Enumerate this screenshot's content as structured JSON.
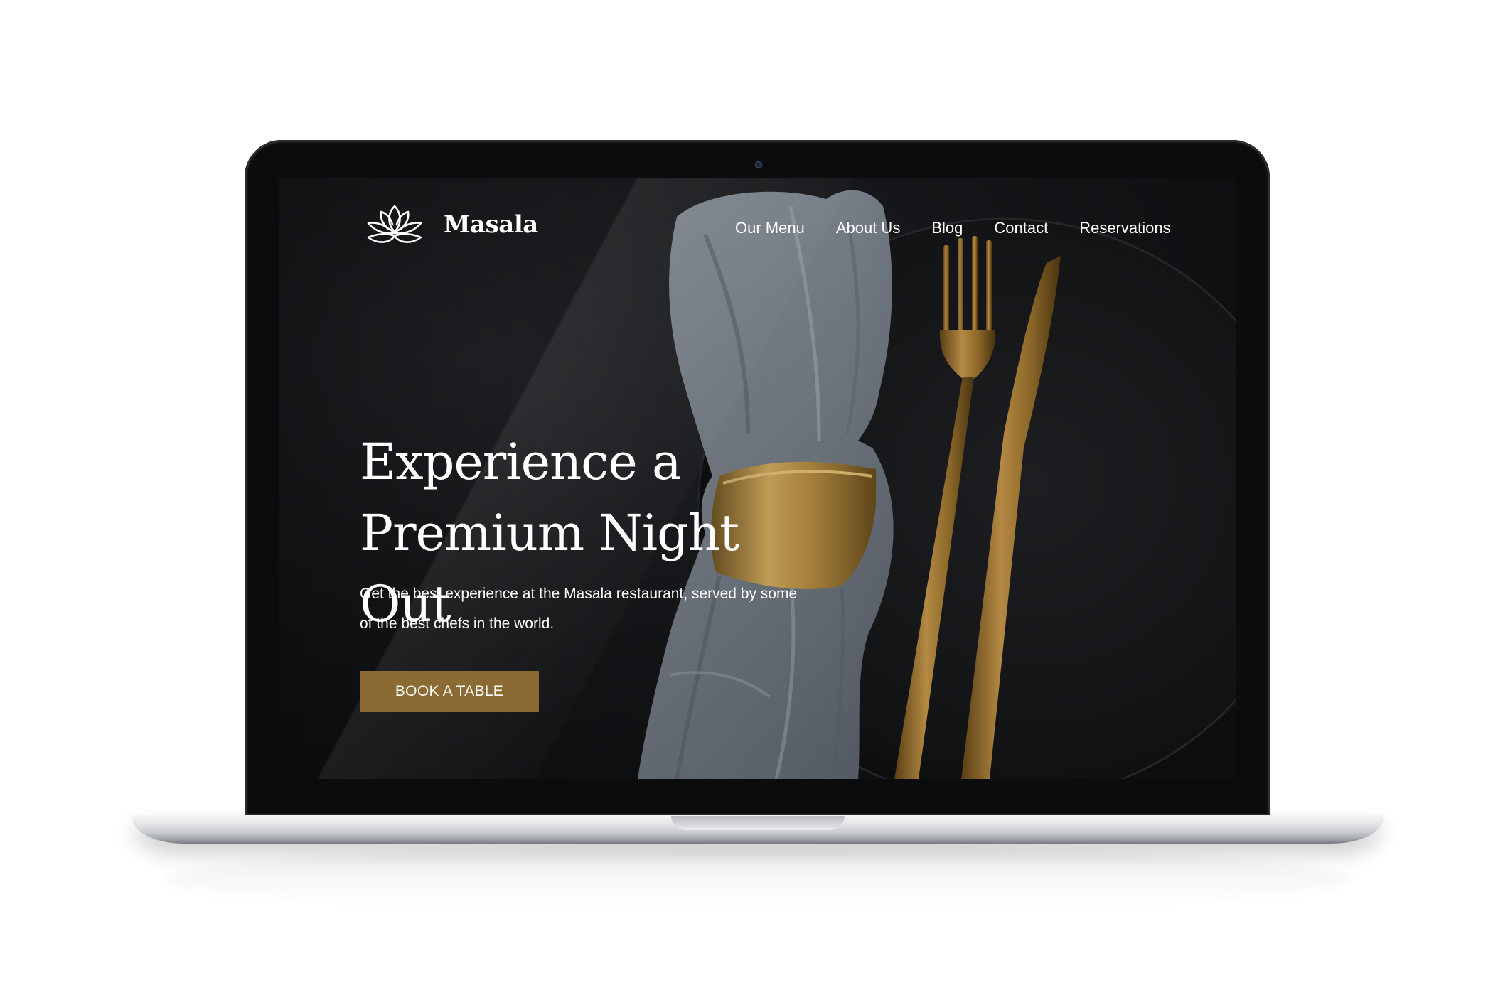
{
  "site": {
    "brand": "Masala",
    "logo_icon": "lotus-icon"
  },
  "nav": {
    "items": [
      {
        "label": "Our Menu"
      },
      {
        "label": "About Us"
      },
      {
        "label": "Blog"
      },
      {
        "label": "Contact"
      },
      {
        "label": "Reservations"
      }
    ]
  },
  "hero": {
    "title_line1": "Experience a",
    "title_line2": "Premium Night Out",
    "subtitle_line1": "Get the best experience at the Masala restaurant, served by some",
    "subtitle_line2": "of the best chefs in the world.",
    "cta_label": "BOOK A TABLE"
  },
  "colors": {
    "background": "#141518",
    "accent_gold": "#8b6a33",
    "text": "#ffffff",
    "napkin": "#7c848d"
  }
}
